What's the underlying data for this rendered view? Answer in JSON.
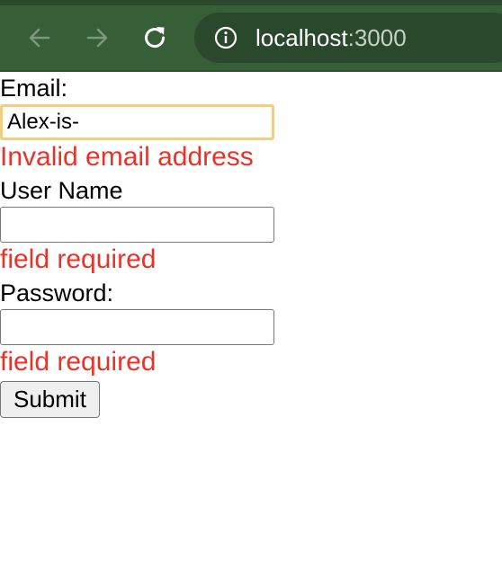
{
  "browser": {
    "url_host": "localhost",
    "url_port": ":3000",
    "icons": {
      "back": "arrow-left-icon",
      "forward": "arrow-right-icon",
      "reload": "reload-icon",
      "site_info": "info-icon"
    }
  },
  "form": {
    "email": {
      "label": "Email:",
      "value": "Alex-is-",
      "error": "Invalid email address"
    },
    "username": {
      "label": "User Name",
      "value": "",
      "error": "field required"
    },
    "password": {
      "label": "Password:",
      "value": "",
      "error": "field required"
    },
    "submit_label": "Submit"
  },
  "colors": {
    "toolbar": "#365e37",
    "error": "#e5352b",
    "focus_ring": "#f2cf7f"
  }
}
